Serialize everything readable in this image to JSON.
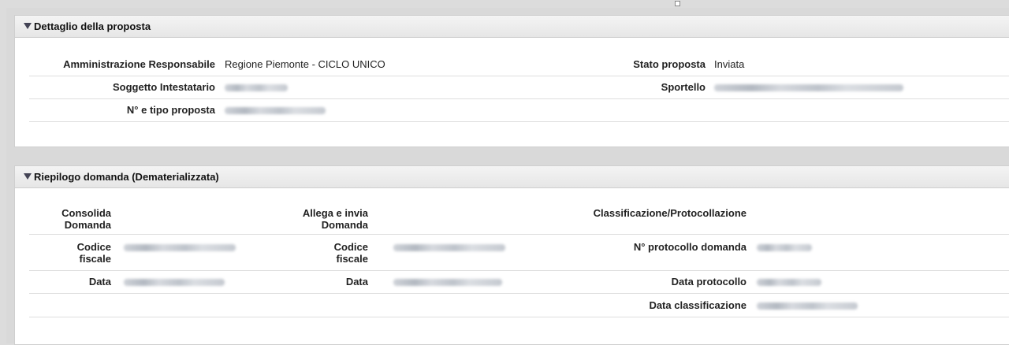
{
  "panel1": {
    "title": "Dettaglio della proposta",
    "fields": {
      "amministrazione_label": "Amministrazione Responsabile",
      "amministrazione_value": "Regione Piemonte - CICLO UNICO",
      "stato_label": "Stato proposta",
      "stato_value": "Inviata",
      "soggetto_label": "Soggetto Intestatario",
      "sportello_label": "Sportello",
      "numero_label": "N° e tipo proposta"
    }
  },
  "panel2": {
    "title": "Riepilogo domanda (Dematerializzata)",
    "fields": {
      "consolida_label": "Consolida Domanda",
      "allega_label": "Allega e invia Domanda",
      "classificazione_label": "Classificazione/Protocollazione",
      "codice_fiscale_label_1": "Codice fiscale",
      "codice_fiscale_label_2": "Codice fiscale",
      "protocollo_domanda_label": "N° protocollo domanda",
      "data_label_1": "Data",
      "data_label_2": "Data",
      "data_protocollo_label": "Data protocollo",
      "data_classificazione_label": "Data classificazione"
    }
  },
  "icons": {
    "expand": "triangle-down-icon"
  }
}
